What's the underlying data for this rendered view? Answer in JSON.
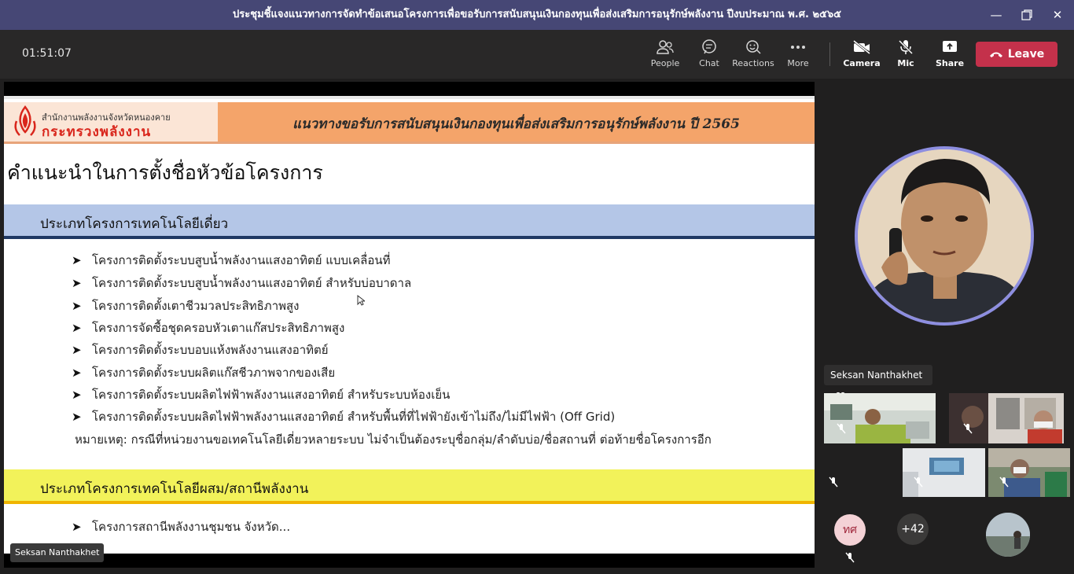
{
  "window": {
    "title": "ประชุมชี้แจงแนวทางการจัดทำข้อเสนอโครงการเพื่อขอรับการสนับสนุนเงินกองทุนเพื่อส่งเสริมการอนุรักษ์พลังงาน ปีงบประมาณ พ.ศ. ๒๕๖๕"
  },
  "toolbar": {
    "timer": "01:51:07",
    "people_label": "People",
    "chat_label": "Chat",
    "reactions_label": "Reactions",
    "more_label": "More",
    "camera_label": "Camera",
    "mic_label": "Mic",
    "share_label": "Share",
    "leave_label": "Leave"
  },
  "slide": {
    "org_small": "สำนักงานพลังงานจังหวัดหนองคาย",
    "org_big": "กระทรวงพลังงาน",
    "banner": "แนวทางขอรับการสนับสนุนเงินกองทุนเพื่อส่งเสริมการอนุรักษ์พลังงาน ปี 2565",
    "heading": "คำแนะนำในการตั้งชื่อหัวข้อโครงการ",
    "section1": "ประเภทโครงการเทคโนโลยีเดี่ยว",
    "bullets1": [
      "โครงการติดตั้งระบบสูบน้ำพลังงานแสงอาทิตย์ แบบเคลื่อนที่",
      "โครงการติดตั้งระบบสูบน้ำพลังงานแสงอาทิตย์ สำหรับบ่อบาดาล",
      "โครงการติดตั้งเตาชีวมวลประสิทธิภาพสูง",
      "โครงการจัดซื้อชุดครอบหัวเตาแก๊สประสิทธิภาพสูง",
      "โครงการติดตั้งระบบอบแห้งพลังงานแสงอาทิตย์",
      "โครงการติดตั้งระบบผลิตแก๊สชีวภาพจากของเสีย",
      "โครงการติดตั้งระบบผลิตไฟฟ้าพลังงานแสงอาทิตย์ สำหรับระบบห้องเย็น",
      "โครงการติดตั้งระบบผลิตไฟฟ้าพลังงานแสงอาทิตย์ สำหรับพื้นที่ที่ไฟฟ้ายังเข้าไม่ถึง/ไม่มีไฟฟ้า (Off Grid)"
    ],
    "note": "หมายเหตุ: กรณีที่หน่วยงานขอเทคโนโลยีเดี่ยวหลายระบบ ไม่จำเป็นต้องระบุชื่อกลุ่ม/ลำดับบ่อ/ชื่อสถานที่ ต่อท้ายชื่อโครงการอีก",
    "section2": "ประเภทโครงการเทคโนโลยีผสม/สถานีพลังงาน",
    "bullets2": [
      "โครงการสถานีพลังงานชุมชน จังหวัด..."
    ]
  },
  "presenter_chip": "Seksan Nanthakhet",
  "speaker_name": "Seksan Nanthakhet",
  "participants": {
    "initials": "ทศ",
    "overflow": "+42"
  },
  "colors": {
    "titlebar": "#464775",
    "leave": "#c4314b",
    "ring": "#8d8ee0"
  }
}
